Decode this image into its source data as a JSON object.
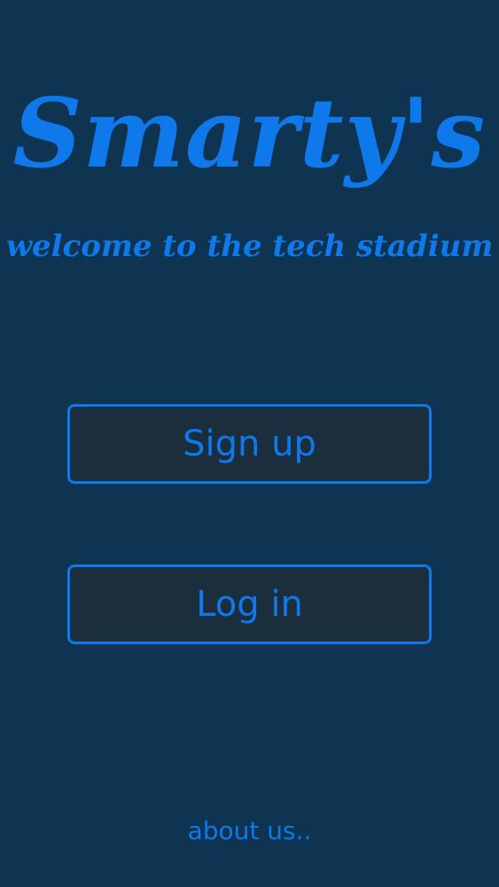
{
  "app": {
    "title": "Smarty's",
    "tagline": "welcome to the tech stadium"
  },
  "actions": {
    "signup_label": "Sign up",
    "login_label": "Log in"
  },
  "footer": {
    "about_label": "about us.."
  },
  "colors": {
    "background": "#0e3451",
    "accent": "#0f78ea",
    "button_fill": "#1b2e3e"
  }
}
